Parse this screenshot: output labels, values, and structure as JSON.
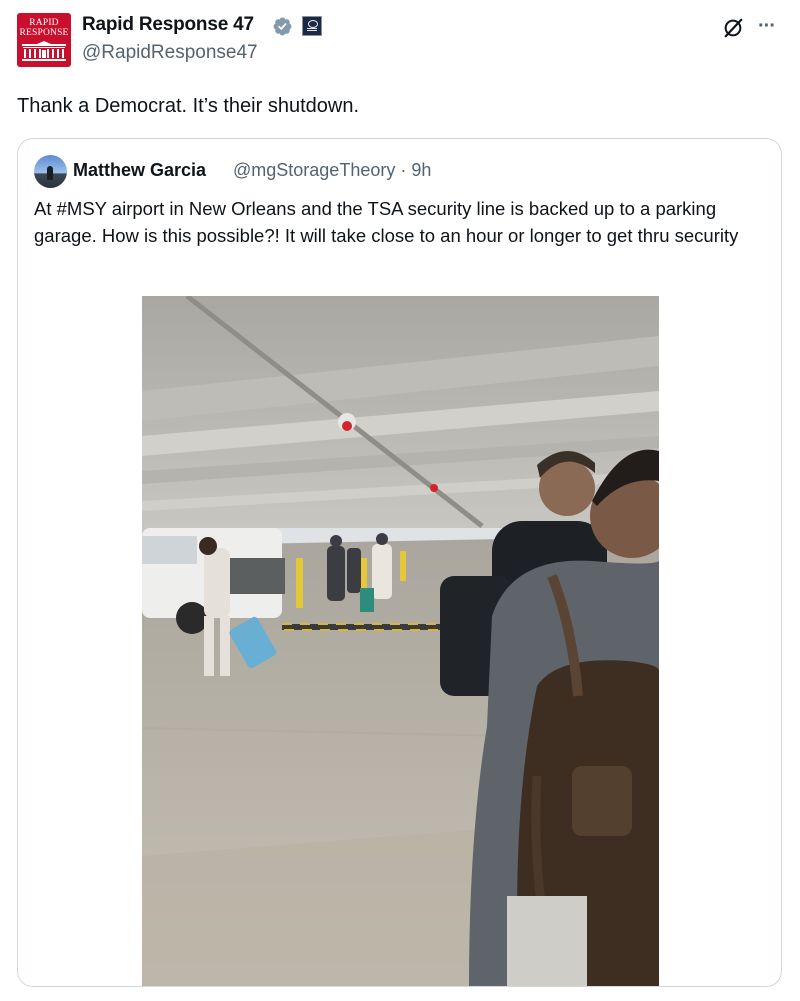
{
  "author": {
    "display_name": "Rapid Response 47",
    "handle": "@RapidResponse47",
    "avatar_text_line1": "RAPID",
    "avatar_text_line2": "RESPONSE",
    "avatar_color": "#c8102e",
    "verified_color": "#829aab"
  },
  "tweet": {
    "text": "Thank a Democrat. It’s their shutdown."
  },
  "icons": {
    "grok": "grok-icon",
    "more": "more-icon",
    "more_glyph": "···"
  },
  "quote": {
    "display_name": "Matthew Garcia",
    "meta": "@mgStorageTheory · 9h",
    "text": "At #MSY airport in New Orleans and the TSA security line is backed up to a parking garage. How is this possible?! It will take close to an hour or longer to get thru security"
  }
}
